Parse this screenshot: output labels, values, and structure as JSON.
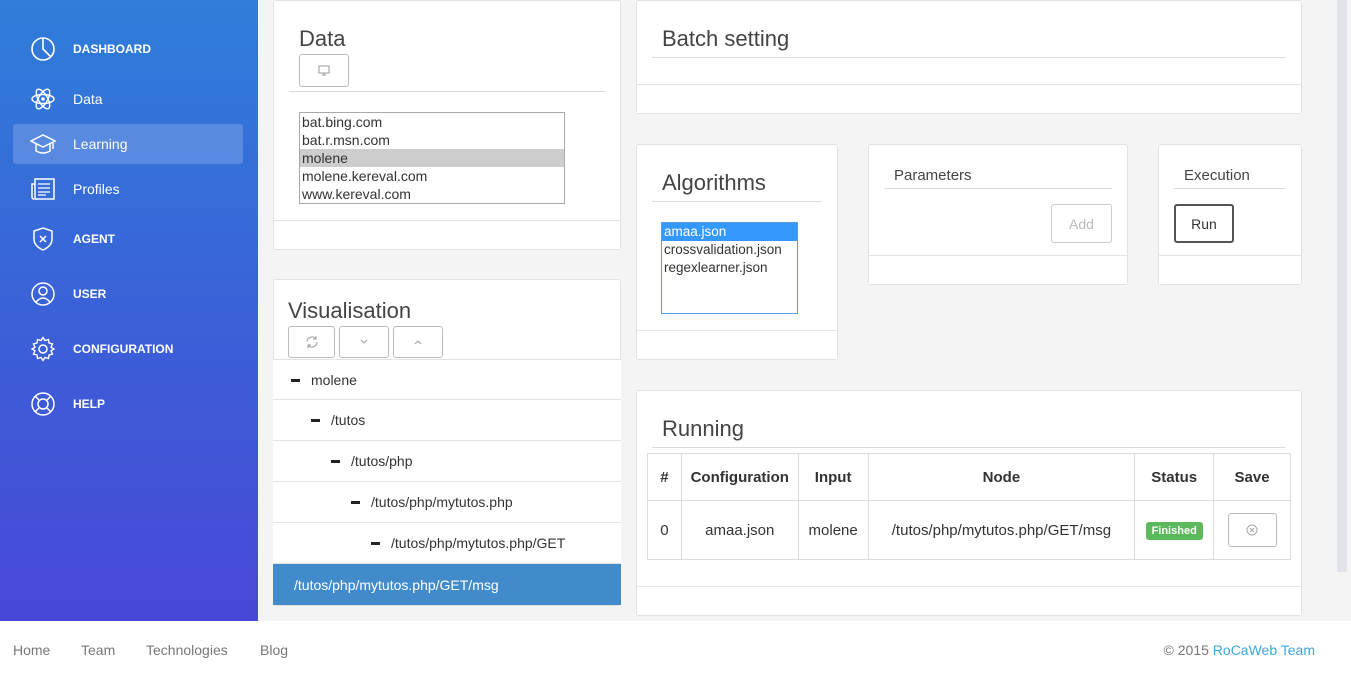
{
  "sidebar": {
    "items": [
      {
        "label": "DASHBOARD",
        "icon": "pie-chart-icon"
      },
      {
        "label": "Data",
        "icon": "atom-icon"
      },
      {
        "label": "Learning",
        "icon": "graduation-cap-icon",
        "active": true
      },
      {
        "label": "Profiles",
        "icon": "newspaper-icon"
      },
      {
        "label": "AGENT",
        "icon": "shield-icon"
      },
      {
        "label": "USER",
        "icon": "user-icon"
      },
      {
        "label": "CONFIGURATION",
        "icon": "gear-icon"
      },
      {
        "label": "HELP",
        "icon": "lifebuoy-icon"
      }
    ]
  },
  "data_panel": {
    "title": "Data",
    "button_icon": "monitor-icon",
    "options": [
      "bat.bing.com",
      "bat.r.msn.com",
      "molene",
      "molene.kereval.com",
      "www.kereval.com"
    ],
    "selected": "molene"
  },
  "visualisation": {
    "title": "Visualisation",
    "buttons": [
      "refresh-icon",
      "chevron-down-icon",
      "chevron-up-icon"
    ],
    "tree": [
      {
        "label": "molene",
        "depth": 0
      },
      {
        "label": "/tutos",
        "depth": 1
      },
      {
        "label": "/tutos/php",
        "depth": 2
      },
      {
        "label": "/tutos/php/mytutos.php",
        "depth": 3
      },
      {
        "label": "/tutos/php/mytutos.php/GET",
        "depth": 4
      },
      {
        "label": "/tutos/php/mytutos.php/GET/msg",
        "depth": 5,
        "active": true
      }
    ]
  },
  "batch": {
    "title": "Batch setting"
  },
  "algorithms": {
    "title": "Algorithms",
    "options": [
      "amaa.json",
      "crossvalidation.json",
      "regexlearner.json"
    ],
    "selected": "amaa.json"
  },
  "parameters": {
    "title": "Parameters",
    "add_label": "Add"
  },
  "execution": {
    "title": "Execution",
    "run_label": "Run"
  },
  "running": {
    "title": "Running",
    "columns": [
      "#",
      "Configuration",
      "Input",
      "Node",
      "Status",
      "Save"
    ],
    "rows": [
      {
        "index": "0",
        "configuration": "amaa.json",
        "input": "molene",
        "node": "/tutos/php/mytutos.php/GET/msg",
        "status": "Finished",
        "save_icon": "circle-x-icon"
      }
    ]
  },
  "footer": {
    "links": [
      "Home",
      "Team",
      "Technologies",
      "Blog"
    ],
    "copyright": "© 2015 ",
    "brand": "RoCaWeb Team"
  },
  "colors": {
    "sidebar_top": "#2f7ed9",
    "sidebar_bottom": "#4848d6",
    "active_tree": "#428bca",
    "status_success": "#5cb85c",
    "brand_link": "#3aa8d8"
  }
}
